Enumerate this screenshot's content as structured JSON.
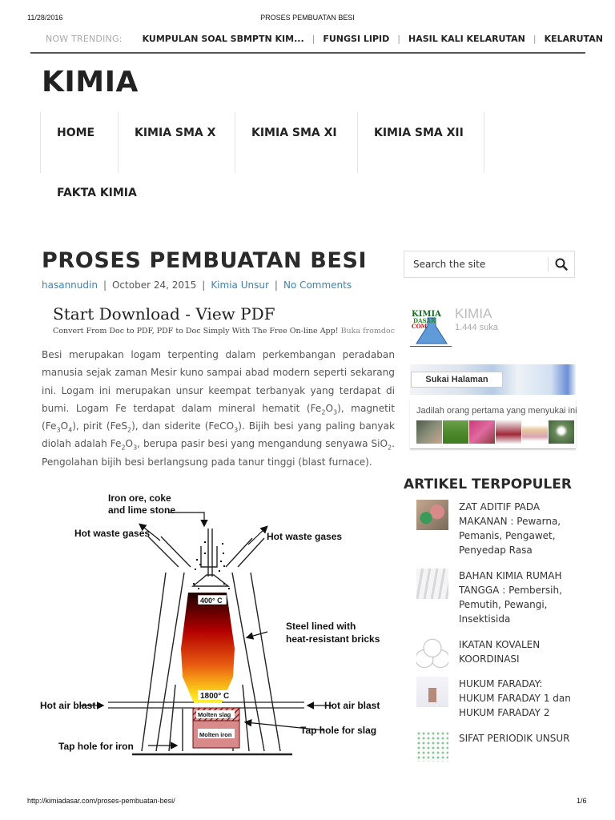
{
  "print_header": {
    "date": "11/28/2016",
    "title": "PROSES PEMBUATAN BESI"
  },
  "trending": {
    "label": "NOW TRENDING:",
    "items": [
      "KUMPULAN SOAL SBMPTN KIM...",
      "FUNGSI LIPID",
      "HASIL KALI KELARUTAN",
      "KELARUTAN"
    ],
    "separator": "|"
  },
  "site": {
    "title": "KIMIA"
  },
  "nav": {
    "items": [
      "HOME",
      "KIMIA SMA X",
      "KIMIA SMA XI",
      "KIMIA SMA XII"
    ],
    "second_row": "FAKTA KIMIA"
  },
  "post": {
    "title": "PROSES PEMBUATAN BESI",
    "author": "hasannudin",
    "date": "October 24, 2015",
    "category": "Kimia Unsur",
    "comments": "No Comments",
    "separator": "|"
  },
  "ad": {
    "title": "Start Download - View PDF",
    "text": "Convert From Doc to PDF, PDF to Doc Simply With The Free On-line App!",
    "link": "Buka fromdoc"
  },
  "body": {
    "p1": "Besi merupakan logam terpenting dalam perkembangan peradaban manusia sejak zaman Mesir kuno sampai abad modern seperti sekarang ini. Logam ini merupakan unsur keempat terbanyak yang terdapat di bumi. Logam Fe terdapat dalam mineral hematit (",
    "f1a": "Fe",
    "f1b": "2",
    "f1c": "O",
    "f1d": "3",
    "t2": "), magnetit (",
    "f2a": "Fe",
    "f2b": "3",
    "f2c": "O",
    "f2d": "4",
    "t3": "), pirit (",
    "f3a": "FeS",
    "f3b": "2",
    "t4": "), dan siderite (",
    "f4a": "FeCO",
    "f4b": "3",
    "t5": "). Bijih besi yang paling banyak diolah adalah ",
    "f5a": "Fe",
    "f5b": "2",
    "f5c": "O",
    "f5d": "3",
    "t6": ", berupa pasir besi yang mengandung senyawa ",
    "f6a": "SiO",
    "f6b": "2",
    "t7": ". Pengolahan bijih besi berlangsung pada tanur tinggi (blast furnace)."
  },
  "diagram": {
    "labels": {
      "input1": "Iron ore, coke",
      "input2": "and lime stone",
      "waste_left": "Hot waste gases",
      "waste_right": "Hot waste gases",
      "temp_top": "400° C",
      "lining1": "Steel lined with",
      "lining2": "heat-resistant bricks",
      "temp_bottom": "1800° C",
      "air_left": "Hot air blast",
      "air_right": "Hot air blast",
      "slag": "Molten slag",
      "iron": "Molten iron",
      "tap_slag": "Tap hole for slag",
      "tap_iron": "Tap hole for iron"
    }
  },
  "sidebar": {
    "search_placeholder": "Search the site",
    "facebook": {
      "page_name": "KIMIA",
      "likes": "1.444 suka",
      "like_button": "Sukai Halaman",
      "friends_text": "Jadilah orang pertama yang menyukai ini",
      "logo_text": [
        "KIMIA",
        "DASAR",
        "COM"
      ]
    },
    "popular": {
      "title": "ARTIKEL TERPOPULER",
      "items": [
        {
          "caps": "ZAT ADITIF PADA MAKANAN :",
          "rest": " Pewarna, Pemanis, Pengawet, Penyedap Rasa"
        },
        {
          "caps": "BAHAN KIMIA RUMAH TANGGA :",
          "rest": " Pembersih, Pemutih, Pewangi, Insektisida"
        },
        {
          "caps": "IKATAN KOVALEN KOORDINASI",
          "rest": ""
        },
        {
          "caps": "HUKUM FARADAY: HUKUM FARADAY 1 dan HUKUM FARADAY 2",
          "rest": ""
        },
        {
          "caps": "SIFAT PERIODIK UNSUR",
          "rest": ""
        }
      ]
    }
  },
  "print_footer": {
    "url": "http://kimiadasar.com/proses-pembuatan-besi/",
    "page": "1/6"
  }
}
